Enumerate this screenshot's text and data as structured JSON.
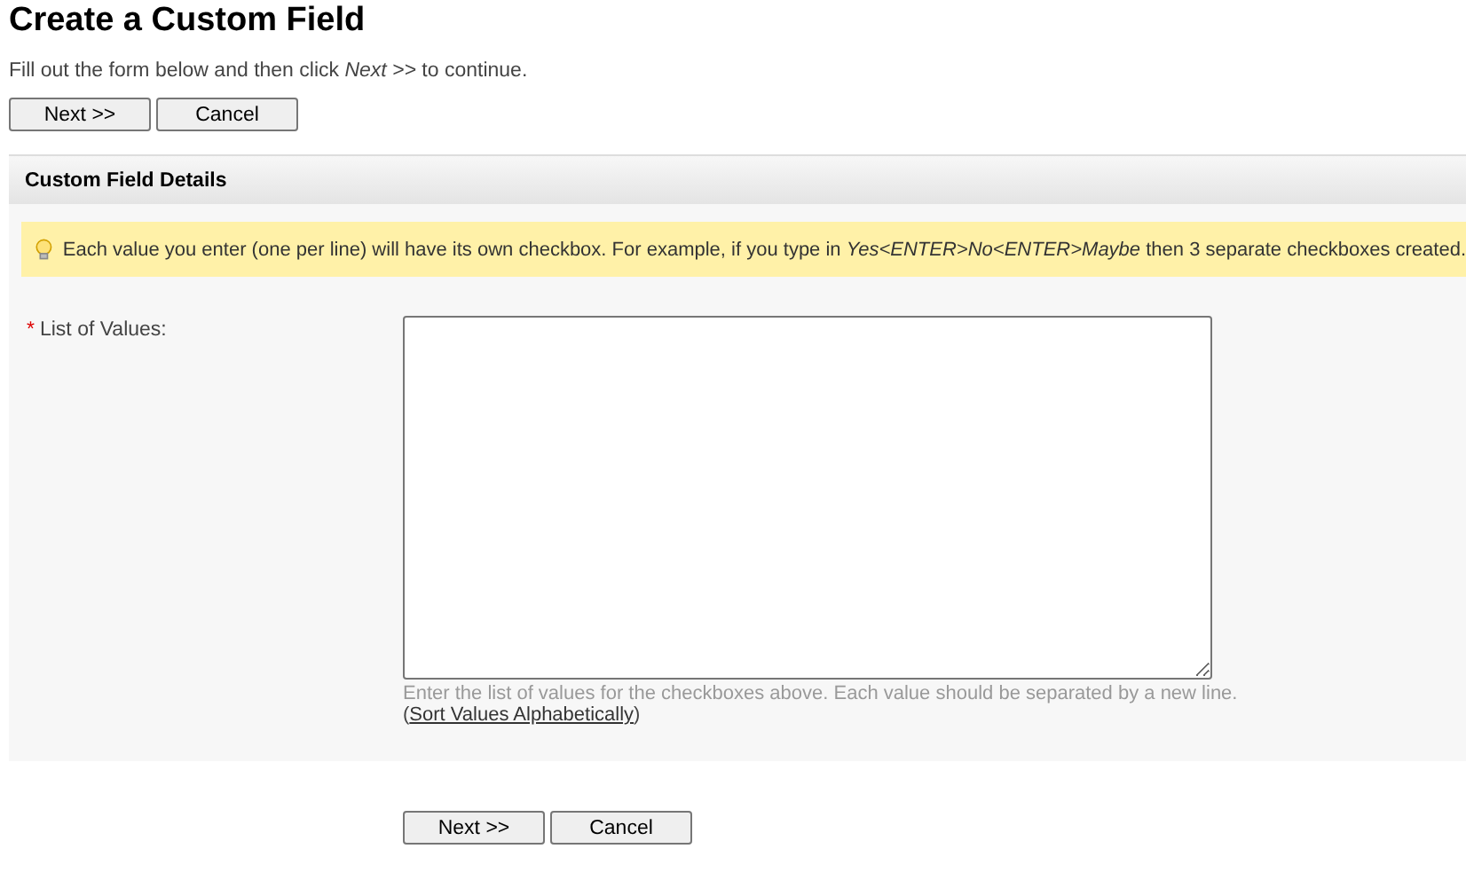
{
  "page": {
    "title": "Create a Custom Field",
    "instructions": "Fill out the form below and then click *Next >>* to continue."
  },
  "top_buttons": [
    "Next >>",
    "Cancel"
  ],
  "section": {
    "title": "Custom Field Details",
    "tip": "Each value you enter (one per line) will have its own checkbox. For example, if you type in *Yes<ENTER>No<ENTER>Maybe* then 3 separate checkboxes created.",
    "field": {
      "required_mark": "*",
      "label": "List of Values:",
      "hint": "Enter the list of values for the checkboxes above. Each value should be separated by a new line.",
      "link_open": "(",
      "link": "Sort Values Alphabetically",
      "link_close": ")"
    }
  },
  "bottom_buttons": [
    "Next >>",
    "Cancel"
  ]
}
